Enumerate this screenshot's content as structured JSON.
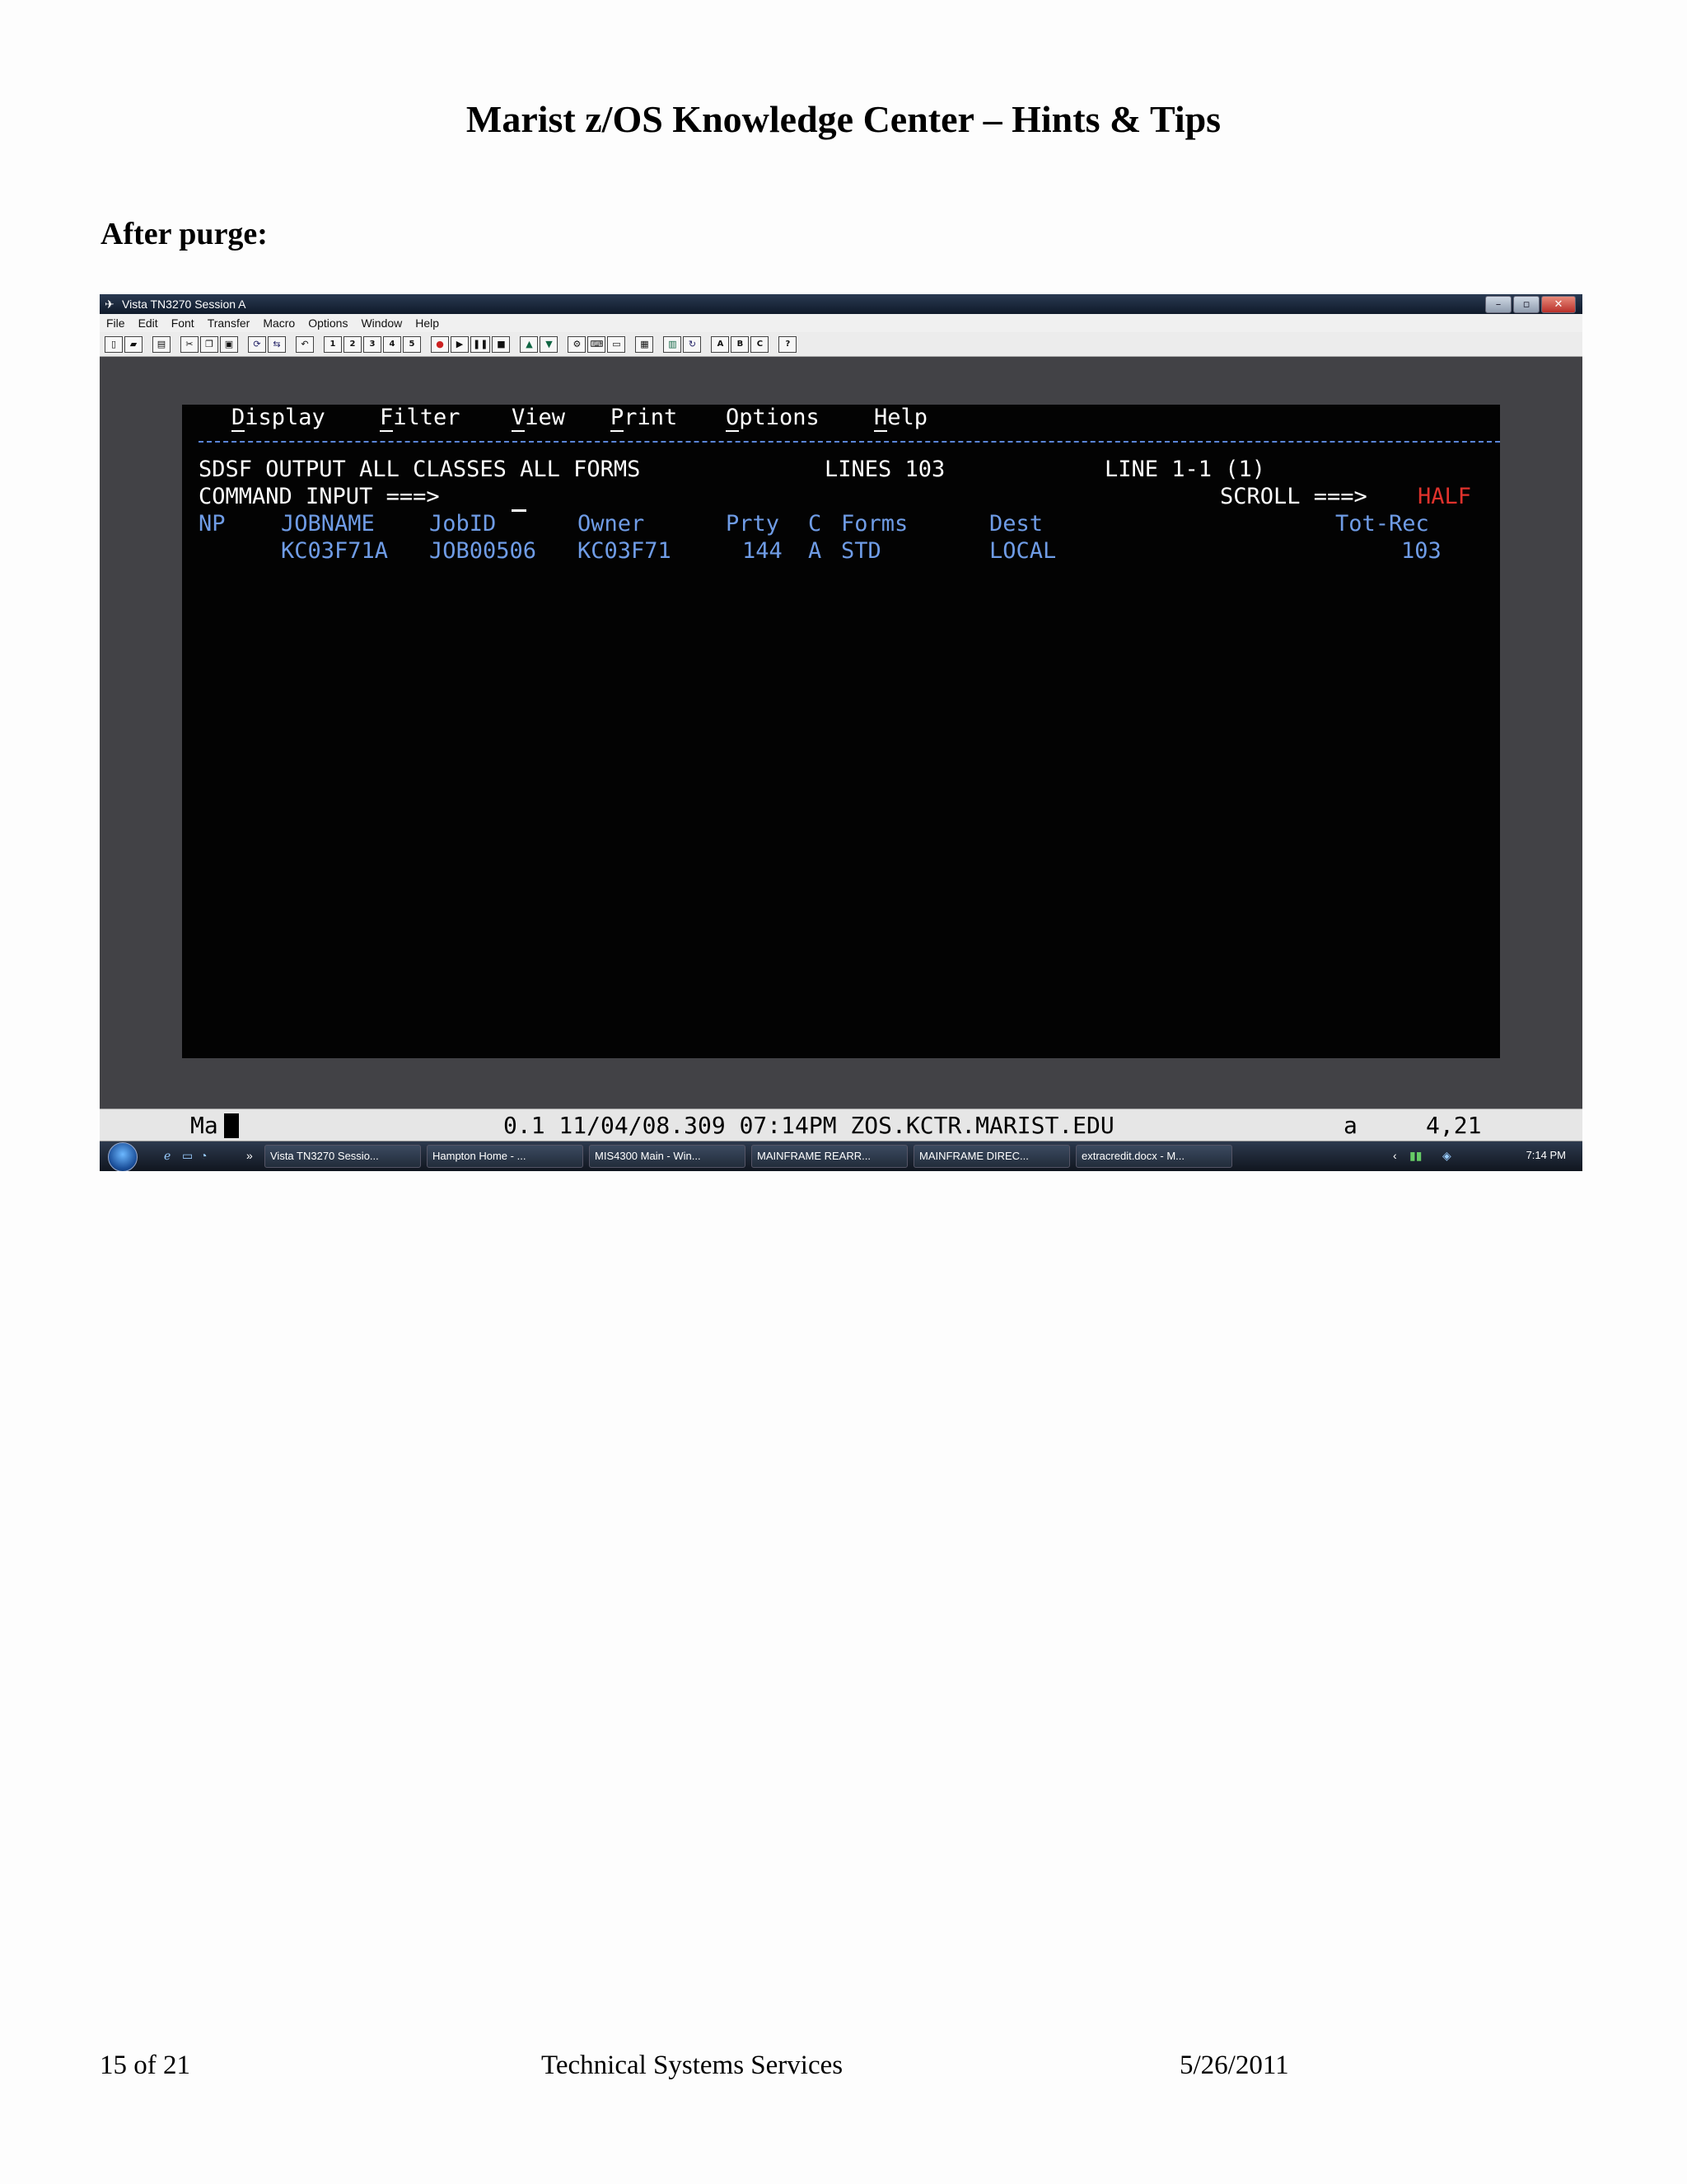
{
  "page": {
    "title": "Marist z/OS Knowledge Center – Hints & Tips",
    "section_heading": "After purge:"
  },
  "window": {
    "title": "Vista TN3270 Session A",
    "controls": [
      "–",
      "▫",
      "✕"
    ],
    "menu": [
      "File",
      "Edit",
      "Font",
      "Transfer",
      "Macro",
      "Options",
      "Window",
      "Help"
    ],
    "toolbar_macro_buttons": [
      "1",
      "2",
      "3",
      "4",
      "5"
    ],
    "toolbar_letter_buttons": [
      "A",
      "B",
      "C"
    ],
    "toolbar_help": "?"
  },
  "terminal": {
    "action_bar": [
      {
        "hotkey": "D",
        "rest": "isplay"
      },
      {
        "hotkey": "F",
        "rest": "ilter"
      },
      {
        "hotkey": "V",
        "rest": "iew"
      },
      {
        "hotkey": "P",
        "rest": "rint"
      },
      {
        "hotkey": "O",
        "rest": "ptions"
      },
      {
        "hotkey": "H",
        "rest": "elp"
      }
    ],
    "panel_title": "SDSF OUTPUT ALL CLASSES ALL FORMS",
    "lines": "LINES 103",
    "line_range": "LINE 1-1 (1)",
    "command_label": "COMMAND INPUT ===>",
    "scroll_label": "SCROLL ===>",
    "scroll_value": "HALF",
    "columns": [
      "NP",
      "JOBNAME",
      "JobID",
      "Owner",
      "Prty",
      "C",
      "Forms",
      "Dest",
      "Tot-Rec"
    ],
    "rows": [
      {
        "np": "",
        "jobname": "KC03F71A",
        "jobid": "JOB00506",
        "owner": "KC03F71",
        "prty": "144",
        "c": "A",
        "forms": "STD",
        "dest": "LOCAL",
        "tot_rec": "103"
      }
    ]
  },
  "status_bar": {
    "left": "Ma",
    "center": "0.1 11/04/08.309 07:14PM ZOS.KCTR.MARIST.EDU",
    "mode": "a",
    "cursor_pos": "4,21"
  },
  "taskbar": {
    "more": "»",
    "tasks": [
      "Vista TN3270 Sessio...",
      "Hampton Home - ...",
      "MIS4300 Main - Win...",
      "MAINFRAME REARR...",
      "MAINFRAME DIREC...",
      "extracredit.docx - M..."
    ],
    "clock": "7:14 PM"
  },
  "footer": {
    "page": "15 of 21",
    "org": "Technical Systems Services",
    "date": "5/26/2011"
  },
  "colors": {
    "terminal_bg": "#030303",
    "terminal_blue": "#6f9ce6",
    "terminal_red": "#e0322c",
    "console_bg": "#424246"
  }
}
